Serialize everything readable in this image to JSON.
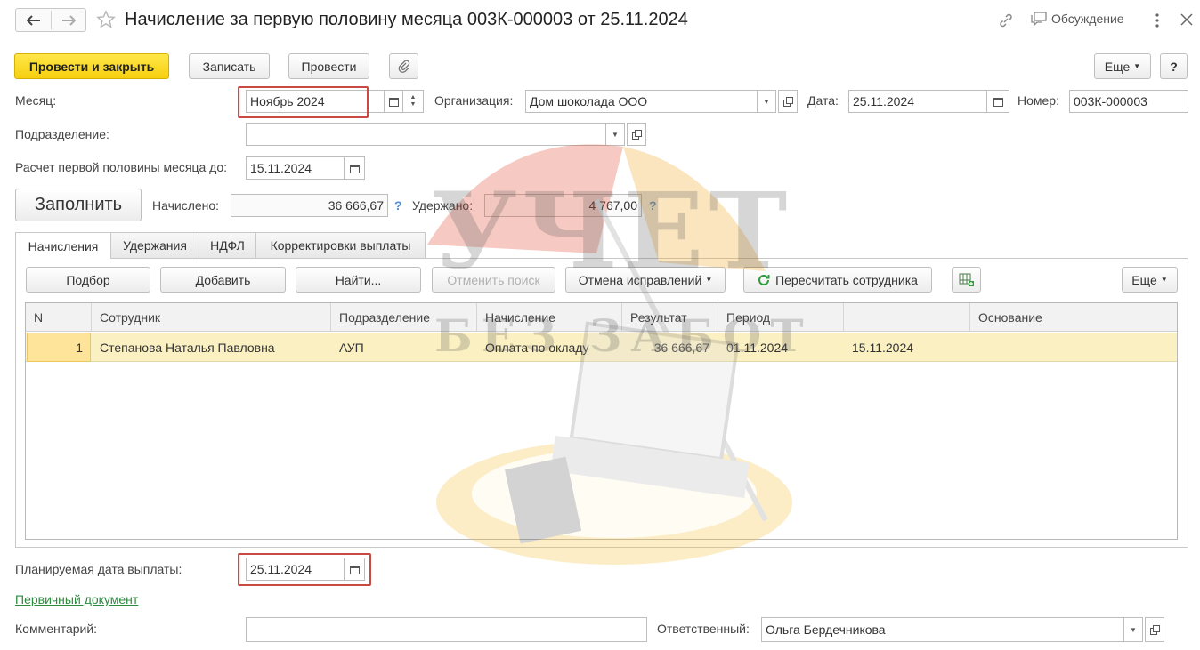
{
  "window": {
    "title": "Начисление за первую половину месяца 003К-000003 от 25.11.2024",
    "discussion_label": "Обсуждение"
  },
  "toolbar": {
    "post_and_close": "Провести и закрыть",
    "save": "Записать",
    "post": "Провести",
    "more": "Еще",
    "help": "?"
  },
  "header": {
    "month_label": "Месяц:",
    "month_value": "Ноябрь 2024",
    "org_label": "Организация:",
    "org_value": "Дом шоколада ООО",
    "date_label": "Дата:",
    "date_value": "25.11.2024",
    "number_label": "Номер:",
    "number_value": "003К-000003",
    "division_label": "Подразделение:",
    "division_value": "",
    "calc_until_label": "Расчет первой половины месяца до:",
    "calc_until_value": "15.11.2024"
  },
  "summary": {
    "fill_button": "Заполнить",
    "accrued_label": "Начислено:",
    "accrued_value": "36 666,67",
    "withheld_label": "Удержано:",
    "withheld_value": "4 767,00",
    "hint": "?"
  },
  "tabs": [
    {
      "label": "Начисления"
    },
    {
      "label": "Удержания"
    },
    {
      "label": "НДФЛ"
    },
    {
      "label": "Корректировки выплаты"
    }
  ],
  "table_toolbar": {
    "select": "Подбор",
    "add": "Добавить",
    "find": "Найти...",
    "cancel_search": "Отменить поиск",
    "cancel_corrections": "Отмена исправлений",
    "recalculate": "Пересчитать сотрудника",
    "more": "Еще"
  },
  "table": {
    "columns": [
      "N",
      "Сотрудник",
      "Подразделение",
      "Начисление",
      "Результат",
      "Период",
      "",
      "Основание"
    ],
    "rows": [
      {
        "n": "1",
        "employee": "Степанова Наталья Павловна",
        "division": "АУП",
        "accrual": "Оплата по окладу",
        "result": "36 666,67",
        "period_from": "01.11.2024",
        "period_to": "15.11.2024",
        "basis": ""
      }
    ]
  },
  "footer": {
    "planned_date_label": "Планируемая дата выплаты:",
    "planned_date_value": "25.11.2024",
    "primary_doc_link": "Первичный документ",
    "comment_label": "Комментарий:",
    "comment_value": "",
    "responsible_label": "Ответственный:",
    "responsible_value": "Ольга Бердечникова"
  },
  "watermark": {
    "line1": "УЧЕТ",
    "line2": "БЕЗ ЗАБОТ"
  },
  "colors": {
    "primary_button": "#f6cf0e",
    "highlight_row": "#fbf0c2",
    "selected_cell": "#fde49a",
    "annotation_box": "#c94a44",
    "link": "#2e8b3e"
  }
}
